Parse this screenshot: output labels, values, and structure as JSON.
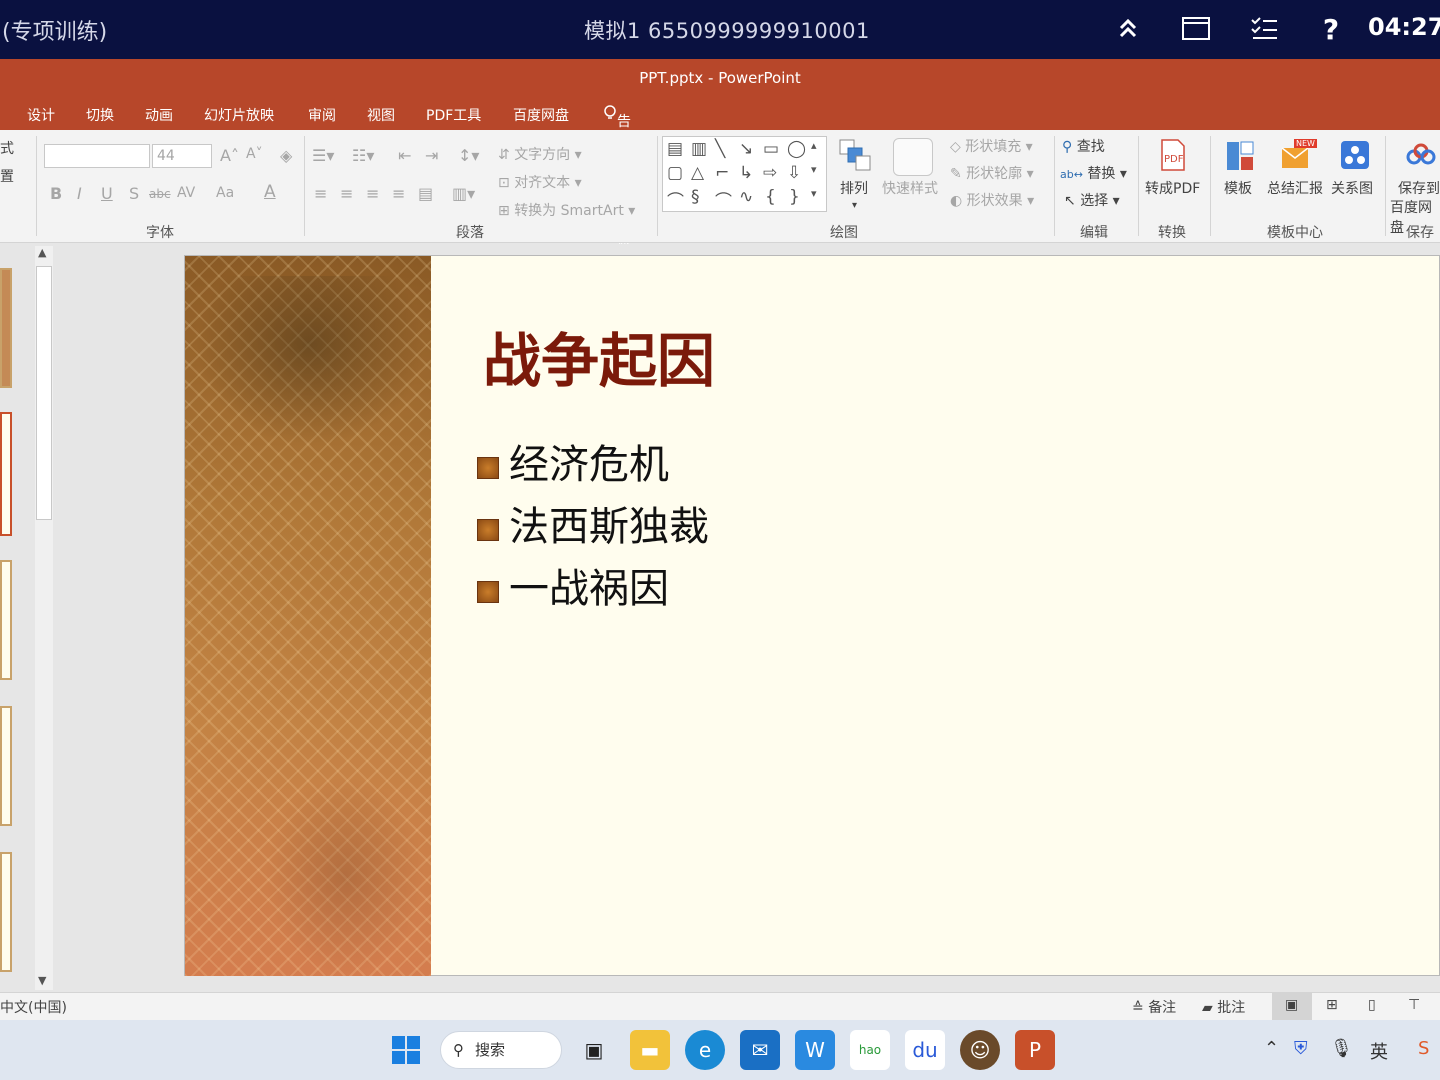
{
  "topbar": {
    "left_text": "(专项训练)",
    "center_text": "模拟1  6550999999910001",
    "time": "04:27",
    "icons": [
      "collapse-up-icon",
      "window-icon",
      "checklist-icon",
      "help-icon"
    ],
    "help_glyph": "?"
  },
  "window": {
    "title": "PPT.pptx - PowerPoint"
  },
  "menu": {
    "design": "设计",
    "transitions": "切换",
    "animations": "动画",
    "slideshow": "幻灯片放映",
    "review": "审阅",
    "view": "视图",
    "pdf": "PDF工具",
    "baidu": "百度网盘",
    "tellme": "告诉我您想要做什么..."
  },
  "ribbon": {
    "left_cut": {
      "a": "式",
      "b": "置"
    },
    "font": {
      "size": "44",
      "label": "字体",
      "bold": "B",
      "italic": "I",
      "underline": "U",
      "shadow": "S",
      "strike": "abc",
      "spacing": "AV",
      "case": "Aa",
      "color": "A"
    },
    "paragraph": {
      "label": "段落",
      "text_dir": "文字方向",
      "align_text": "对齐文本",
      "smartart": "转换为 SmartArt"
    },
    "drawing": {
      "label": "绘图",
      "arrange": "排列",
      "quick_styles": "快速样式",
      "fill": "形状填充",
      "outline": "形状轮廓",
      "effect": "形状效果"
    },
    "editing": {
      "label": "编辑",
      "find": "查找",
      "replace": "替换",
      "select": "选择"
    },
    "convert": {
      "label": "转换",
      "to_pdf": "转成PDF"
    },
    "template_center": {
      "label": "模板中心",
      "template": "模板",
      "summary": "总结汇报",
      "relation": "关系图",
      "new_badge": "NEW"
    },
    "save": {
      "label": "保存",
      "line1": "保存到",
      "line2": "百度网盘"
    }
  },
  "slide": {
    "title": "战争起因",
    "bullets": [
      "经济危机",
      "法西斯独裁",
      "一战祸因"
    ]
  },
  "status": {
    "language": "中文(中国)",
    "notes": "备注",
    "comments": "批注"
  },
  "taskbar": {
    "search": "搜索",
    "apps": [
      "windows-start-icon",
      "task-view-icon",
      "file-explorer-icon",
      "edge-icon",
      "mail-icon",
      "wps-icon",
      "hao123-icon",
      "baidu-netdisk-icon",
      "avatar-app-icon",
      "powerpoint-icon"
    ],
    "tray_lang": "英"
  },
  "colors": {
    "accent": "#b7472a",
    "topbar": "#0a1140",
    "slide_title": "#7b1a0a"
  }
}
